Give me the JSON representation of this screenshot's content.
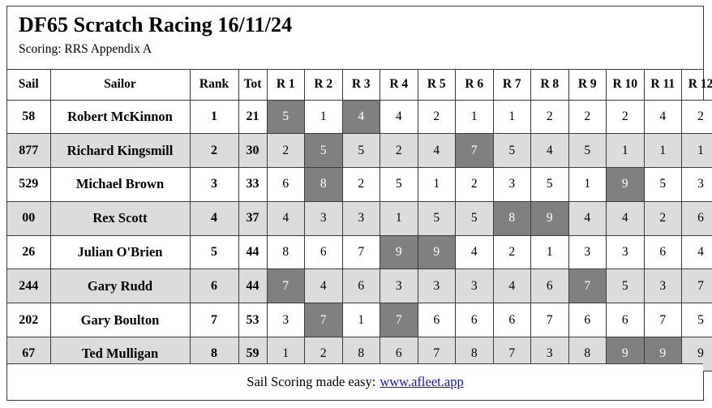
{
  "header": {
    "title": "DF65 Scratch Racing 16/11/24",
    "scoring": "Scoring: RRS Appendix A"
  },
  "table": {
    "columns": [
      "Sail",
      "Sailor",
      "Rank",
      "Tot",
      "R 1",
      "R 2",
      "R 3",
      "R 4",
      "R 5",
      "R 6",
      "R 7",
      "R 8",
      "R 9",
      "R 10",
      "R 11",
      "R 12"
    ],
    "rows": [
      {
        "sail": "58",
        "sailor": "Robert McKinnon",
        "rank": "1",
        "tot": "21",
        "races": [
          "5",
          "1",
          "4",
          "4",
          "2",
          "1",
          "1",
          "2",
          "2",
          "2",
          "4",
          "2"
        ],
        "discards": [
          0,
          2
        ]
      },
      {
        "sail": "877",
        "sailor": "Richard Kingsmill",
        "rank": "2",
        "tot": "30",
        "races": [
          "2",
          "5",
          "5",
          "2",
          "4",
          "7",
          "5",
          "4",
          "5",
          "1",
          "1",
          "1"
        ],
        "discards": [
          1,
          5
        ]
      },
      {
        "sail": "529",
        "sailor": "Michael Brown",
        "rank": "3",
        "tot": "33",
        "races": [
          "6",
          "8",
          "2",
          "5",
          "1",
          "2",
          "3",
          "5",
          "1",
          "9",
          "5",
          "3"
        ],
        "discards": [
          1,
          9
        ]
      },
      {
        "sail": "00",
        "sailor": "Rex Scott",
        "rank": "4",
        "tot": "37",
        "races": [
          "4",
          "3",
          "3",
          "1",
          "5",
          "5",
          "8",
          "9",
          "4",
          "4",
          "2",
          "6"
        ],
        "discards": [
          6,
          7
        ]
      },
      {
        "sail": "26",
        "sailor": "Julian O'Brien",
        "rank": "5",
        "tot": "44",
        "races": [
          "8",
          "6",
          "7",
          "9",
          "9",
          "4",
          "2",
          "1",
          "3",
          "3",
          "6",
          "4"
        ],
        "discards": [
          3,
          4
        ]
      },
      {
        "sail": "244",
        "sailor": "Gary Rudd",
        "rank": "6",
        "tot": "44",
        "races": [
          "7",
          "4",
          "6",
          "3",
          "3",
          "3",
          "4",
          "6",
          "7",
          "5",
          "3",
          "7"
        ],
        "discards": [
          0,
          8
        ]
      },
      {
        "sail": "202",
        "sailor": "Gary Boulton",
        "rank": "7",
        "tot": "53",
        "races": [
          "3",
          "7",
          "1",
          "7",
          "6",
          "6",
          "6",
          "7",
          "6",
          "6",
          "7",
          "5"
        ],
        "discards": [
          1,
          3
        ]
      },
      {
        "sail": "67",
        "sailor": "Ted Mulligan",
        "rank": "8",
        "tot": "59",
        "races": [
          "1",
          "2",
          "8",
          "6",
          "7",
          "8",
          "7",
          "3",
          "8",
          "9",
          "9",
          "9"
        ],
        "discards": [
          9,
          10
        ]
      }
    ]
  },
  "footer": {
    "text": "Sail Scoring made easy:",
    "link_label": "www.afleet.app"
  },
  "colors": {
    "discard_bg": "#808080",
    "stripe_bg": "#dcdcdc",
    "link": "#1414cc",
    "border": "#3a3a3a"
  }
}
